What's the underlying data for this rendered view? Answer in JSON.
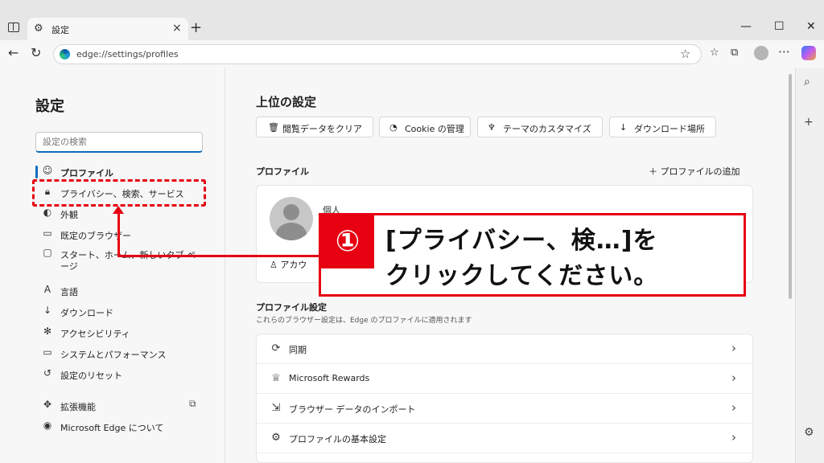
{
  "browser": {
    "tab_title": "設定",
    "url": "edge://settings/profiles"
  },
  "sidebar": {
    "title": "設定",
    "search_placeholder": "設定の検索",
    "items": [
      {
        "label": "プロファイル",
        "icon": "profile-icon"
      },
      {
        "label": "プライバシー、検索、サービス",
        "icon": "lock-icon"
      },
      {
        "label": "外観",
        "icon": "appearance-icon"
      },
      {
        "label": "既定のブラウザー",
        "icon": "browser-icon"
      },
      {
        "label": "スタート、ホーム、新しいタブ ペ",
        "label2": "ージ",
        "icon": "home-icon"
      },
      {
        "label": "言語",
        "icon": "language-icon"
      },
      {
        "label": "ダウンロード",
        "icon": "download-icon"
      },
      {
        "label": "アクセシビリティ",
        "icon": "accessibility-icon"
      },
      {
        "label": "システムとパフォーマンス",
        "icon": "system-icon"
      },
      {
        "label": "設定のリセット",
        "icon": "reset-icon"
      },
      {
        "label": "拡張機能",
        "icon": "extensions-icon"
      },
      {
        "label": "Microsoft Edge について",
        "icon": "edge-icon"
      }
    ]
  },
  "main": {
    "title": "上位の設定",
    "quick_actions": [
      {
        "label": "閲覧データをクリア",
        "icon": "trash-icon"
      },
      {
        "label": "Cookie の管理",
        "icon": "cookie-icon"
      },
      {
        "label": "テーマのカスタマイズ",
        "icon": "brush-icon"
      },
      {
        "label": "ダウンロード場所",
        "icon": "download-icon"
      }
    ],
    "profile_section": "プロファイル",
    "add_profile": "プロファイルの追加",
    "profile_name": "個人",
    "account_label": "アカウ",
    "profile_settings_title": "プロファイル設定",
    "profile_settings_sub": "これらのブラウザー設定は、Edge のプロファイルに適用されます",
    "profile_settings_items": [
      {
        "label": "同期",
        "icon": "sync-icon"
      },
      {
        "label": "Microsoft Rewards",
        "icon": "rewards-icon"
      },
      {
        "label": "ブラウザー データのインポート",
        "icon": "import-icon"
      },
      {
        "label": "プロファイルの基本設定",
        "icon": "profile-prefs-icon"
      }
    ]
  },
  "annotation": {
    "number": "①",
    "line1": "[プライバシー、検…]を",
    "line2": "クリックしてください。",
    "color": "#e60012"
  }
}
